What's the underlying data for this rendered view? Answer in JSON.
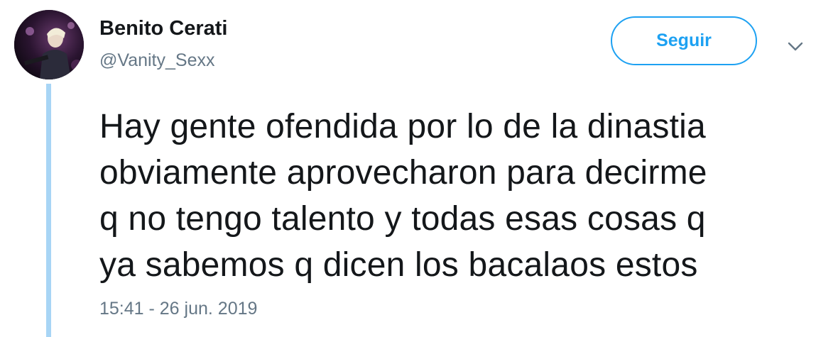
{
  "user": {
    "display_name": "Benito Cerati",
    "handle": "@Vanity_Sexx",
    "avatar_icon": "user-avatar-photo"
  },
  "actions": {
    "follow_label": "Seguir",
    "more_icon": "chevron-down-icon"
  },
  "tweet": {
    "lines": [
      "Hay gente ofendida por lo de la dinastia",
      "obviamente aprovecharon para decirme",
      "q no tengo talento y todas esas cosas q",
      "ya sabemos q dicen los bacalaos estos"
    ],
    "timestamp": "15:41 - 26 jun. 2019"
  },
  "colors": {
    "accent": "#1da1f2",
    "thread_line": "#a8d5f5",
    "secondary_text": "#657786",
    "primary_text": "#14171a"
  }
}
